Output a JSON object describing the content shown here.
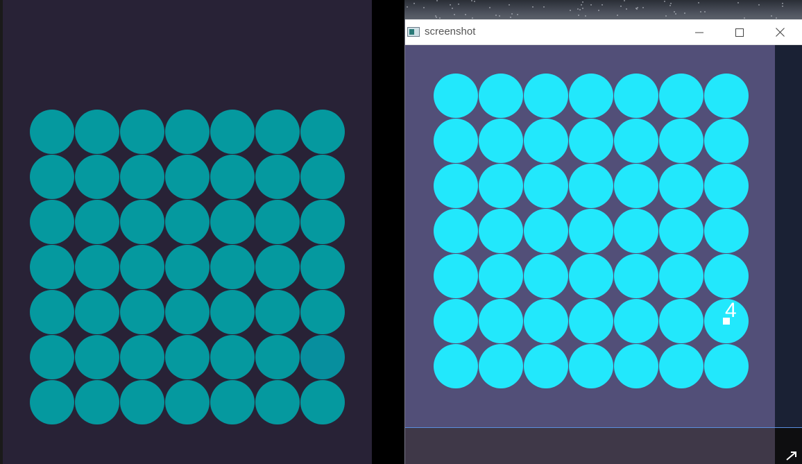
{
  "left_panel": {
    "rows": 7,
    "cols": 7,
    "highlighted_cell": {
      "row": 5,
      "col": 6
    }
  },
  "window": {
    "title": "screenshot",
    "controls": {
      "minimize_icon": "minimize-icon",
      "maximize_icon": "maximize-icon",
      "close_icon": "close-icon"
    }
  },
  "right_panel": {
    "rows": 7,
    "cols": 7,
    "marked_cell": {
      "row": 5,
      "col": 6,
      "label": "4"
    }
  },
  "colors": {
    "left_dot": "#05999f",
    "left_dot_highlight": "#078f9e",
    "right_dot": "#22e8fc",
    "left_background": "#282236",
    "right_background": "#524f78"
  }
}
